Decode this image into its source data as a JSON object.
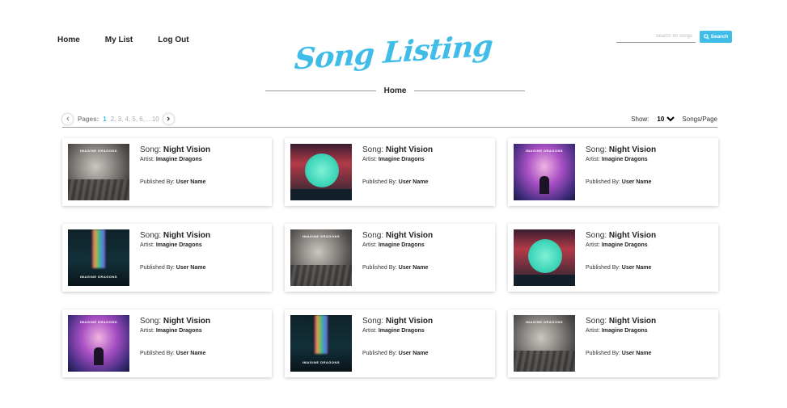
{
  "nav": {
    "home": "Home",
    "my_list": "My List",
    "log_out": "Log Out"
  },
  "logo": {
    "text": "Song Listing"
  },
  "search": {
    "placeholder": "Search for songs",
    "button_label": "Search"
  },
  "breadcrumb": {
    "label": "Home"
  },
  "pagination": {
    "label": "Pages:",
    "current": "1",
    "others": "2, 3, 4, 5, 6,... 10"
  },
  "page_size": {
    "label": "Show:",
    "value": "10",
    "suffix": "Songs/Page"
  },
  "songs": [
    {
      "song_label": "Song:",
      "title": "Night Vision",
      "artist_label": "Artist:",
      "artist": "Imagine Dragons",
      "published_label": "Published By:",
      "publisher": "User Name",
      "cover_text": "IMAGINE DRAGONS"
    },
    {
      "song_label": "Song:",
      "title": "Night Vision",
      "artist_label": "Artist:",
      "artist": "Imagine Dragons",
      "published_label": "Published By:",
      "publisher": "User Name",
      "cover_text": ""
    },
    {
      "song_label": "Song:",
      "title": "Night Vision",
      "artist_label": "Artist:",
      "artist": "Imagine Dragons",
      "published_label": "Published By:",
      "publisher": "User Name",
      "cover_text": "IMAGINE DRAGONS"
    },
    {
      "song_label": "Song:",
      "title": "Night Vision",
      "artist_label": "Artist:",
      "artist": "Imagine Dragons",
      "published_label": "Published By:",
      "publisher": "User Name",
      "cover_text": "IMAGINE DRAGONS"
    },
    {
      "song_label": "Song:",
      "title": "Night Vision",
      "artist_label": "Artist:",
      "artist": "Imagine Dragons",
      "published_label": "Published By:",
      "publisher": "User Name",
      "cover_text": "IMAGINE DRAGONS"
    },
    {
      "song_label": "Song:",
      "title": "Night Vision",
      "artist_label": "Artist:",
      "artist": "Imagine Dragons",
      "published_label": "Published By:",
      "publisher": "User Name",
      "cover_text": ""
    },
    {
      "song_label": "Song:",
      "title": "Night Vision",
      "artist_label": "Artist:",
      "artist": "Imagine Dragons",
      "published_label": "Published By:",
      "publisher": "User Name",
      "cover_text": "IMAGINE DRAGONS"
    },
    {
      "song_label": "Song:",
      "title": "Night Vision",
      "artist_label": "Artist:",
      "artist": "Imagine Dragons",
      "published_label": "Published By:",
      "publisher": "User Name",
      "cover_text": "IMAGINE DRAGONS"
    },
    {
      "song_label": "Song:",
      "title": "Night Vision",
      "artist_label": "Artist:",
      "artist": "Imagine Dragons",
      "published_label": "Published By:",
      "publisher": "User Name",
      "cover_text": "IMAGINE DRAGONS"
    }
  ],
  "colors": {
    "accent": "#3fbde8"
  },
  "icons": {
    "search": "search-icon",
    "prev": "chevron-left-icon",
    "next": "chevron-right-icon",
    "dropdown": "chevron-down-icon"
  }
}
